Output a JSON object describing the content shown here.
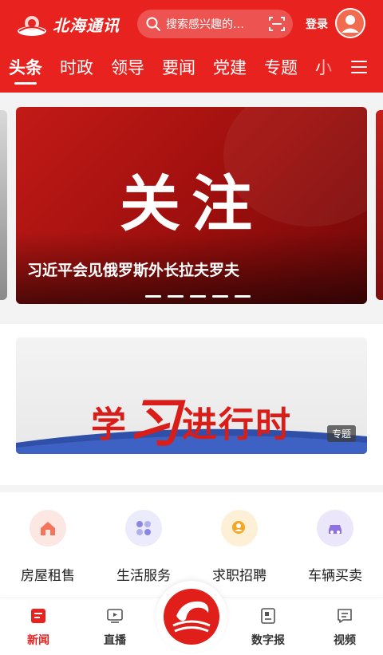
{
  "header": {
    "app_name": "北海通讯",
    "search_placeholder": "搜索感兴趣的…",
    "login_label": "登录",
    "brand_color": "#e8231f"
  },
  "tabs": [
    {
      "label": "头条",
      "active": true
    },
    {
      "label": "时政"
    },
    {
      "label": "领导"
    },
    {
      "label": "要闻"
    },
    {
      "label": "党建"
    },
    {
      "label": "专题"
    },
    {
      "label": "小"
    }
  ],
  "carousel": {
    "title_graphic": "关注",
    "caption": "习近平会见俄罗斯外长拉夫罗夫",
    "slide_count": 5
  },
  "banner": {
    "text_a": "学",
    "text_b": "习",
    "text_c": "进行时",
    "badge": "专题"
  },
  "services": [
    {
      "label": "房屋租售",
      "icon": "house-icon",
      "color": "#f6745c",
      "bg": "#fde7e2"
    },
    {
      "label": "生活服务",
      "icon": "grid-service-icon",
      "color": "#8a86e6",
      "bg": "#ecebfb"
    },
    {
      "label": "求职招聘",
      "icon": "job-search-icon",
      "color": "#f5a623",
      "bg": "#fdf0d6"
    },
    {
      "label": "车辆买卖",
      "icon": "car-icon",
      "color": "#8e72e0",
      "bg": "#ece6fb"
    }
  ],
  "bottom_nav": [
    {
      "label": "新闻",
      "icon": "news-icon",
      "active": true
    },
    {
      "label": "直播",
      "icon": "live-tv-icon"
    },
    {
      "label": "数字报",
      "icon": "newspaper-icon"
    },
    {
      "label": "视频",
      "icon": "video-chat-icon"
    }
  ]
}
